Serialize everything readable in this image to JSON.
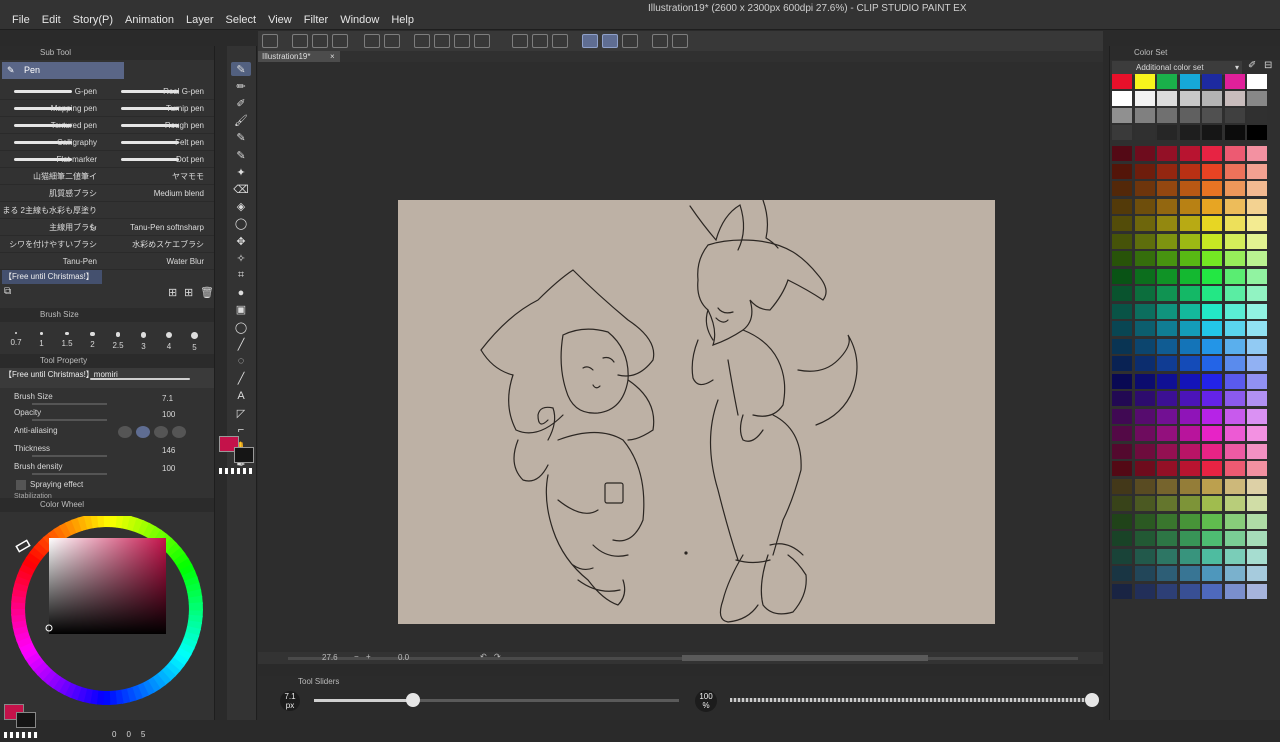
{
  "window_title": "Illustration19* (2600 x 2300px 600dpi 27.6%) - CLIP STUDIO PAINT EX",
  "menu": [
    "File",
    "Edit",
    "Story(P)",
    "Animation",
    "Layer",
    "Select",
    "View",
    "Filter",
    "Window",
    "Help"
  ],
  "document_tab": "Illustration19*",
  "sub_tool": {
    "header": "Sub Tool",
    "group": "Pen",
    "brushes_left": [
      "G-pen",
      "Mapping pen",
      "Textured pen",
      "Calligraphy",
      "Flat marker",
      "山猫細筆二値筆イ",
      "肌質感ブラシ",
      "まる 2主線も水彩も厚塗りも",
      "主線用ブラシ",
      "シワを付けやすいブラシ",
      "Tanu-Pen"
    ],
    "brushes_right": [
      "Real G-pen",
      "Turnip pen",
      "Rough pen",
      "Felt pen",
      "Dot pen",
      "ヤマモモ",
      "Medium blend",
      "",
      "Tanu-Pen softnsharp",
      "水彩めスケエブラシ",
      "Water Blur"
    ],
    "selected_set": "【Free until Christmas!】"
  },
  "brush_size_panel": {
    "header": "Brush Size",
    "presets": [
      "0.7",
      "1",
      "1.5",
      "2",
      "2.5",
      "3",
      "4",
      "5"
    ]
  },
  "tool_property": {
    "header": "Tool Property",
    "preset_name": "【Free until Christmas!】momiri",
    "rows": [
      {
        "label": "Brush Size",
        "value": "7.1"
      },
      {
        "label": "Opacity",
        "value": "100"
      },
      {
        "label": "Anti-aliasing",
        "value": ""
      },
      {
        "label": "Thickness",
        "value": "146"
      },
      {
        "label": "Brush density",
        "value": "100"
      }
    ],
    "spraying": "Spraying effect",
    "stabilization": "Stabilization"
  },
  "color_wheel": {
    "header": "Color Wheel",
    "footer_values": [
      "0",
      "0",
      "5"
    ]
  },
  "colors": {
    "main": "#c4124a",
    "sub": "#151515",
    "accent": "#5f6d92"
  },
  "color_set": {
    "header": "Color Set",
    "set_name": "Additional color set"
  },
  "navigator": {
    "zoom": "27.6",
    "rotation": "0.0"
  },
  "tool_sliders": {
    "header": "Tool Sliders",
    "size_value": "7.1",
    "size_unit": "px",
    "size_level": 0.27,
    "opacity_value": "100",
    "opacity_unit": "%",
    "opacity_level": 1.0
  }
}
